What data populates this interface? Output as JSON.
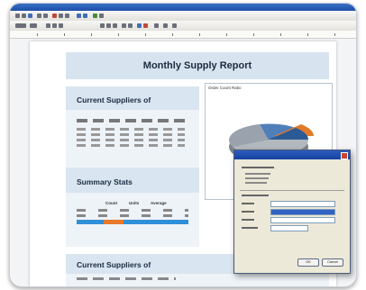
{
  "report": {
    "title": "Monthly Supply Report",
    "section1": "Current Suppliers of",
    "section2": "Summary Stats",
    "section3": "Current Suppliers of",
    "pie_title": "Order Count Ratio",
    "summary_cols": [
      "Count",
      "Units",
      "Average"
    ]
  },
  "colors": {
    "title_bar": "#1e4fa8",
    "band": "#d9e5f1",
    "highlight_orange": "#e8782a",
    "highlight_blue": "#2f8fd8",
    "pie_blue": "#4f7fb8",
    "pie_gray": "#b3b8bf",
    "pie_orange": "#e07a2a"
  },
  "dialog": {
    "ok": "OK",
    "cancel": "Cancel"
  }
}
